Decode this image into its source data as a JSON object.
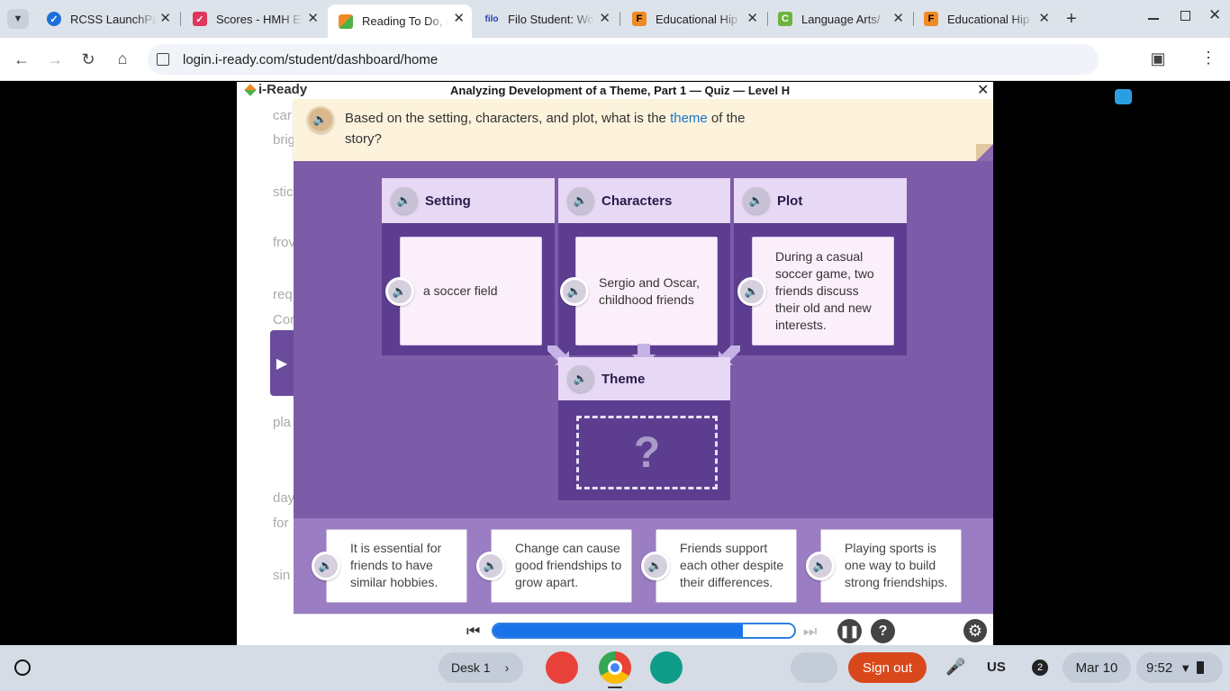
{
  "browser": {
    "tabs": [
      {
        "title": "RCSS LaunchPad",
        "icon": "launchpad-icon",
        "color": "#1e6fd9"
      },
      {
        "title": "Scores - HMH Ed",
        "icon": "hmh-icon",
        "color": "#e0355c"
      },
      {
        "title": "Reading To Do, i-Ready",
        "icon": "iready-icon",
        "color": "#f08a24"
      },
      {
        "title": "Filo Student: World",
        "icon": "filo-icon",
        "color": "#2a3fb0"
      },
      {
        "title": "Educational Hip",
        "icon": "flocabulary-icon",
        "color": "#f08a24"
      },
      {
        "title": "Language Arts/",
        "icon": "commonlit-icon",
        "color": "#6cb33f"
      },
      {
        "title": "Educational Hip",
        "icon": "flocabulary-icon",
        "color": "#f08a24"
      }
    ],
    "url": "login.i-ready.com/student/dashboard/home"
  },
  "quiz": {
    "brand": "i-Ready",
    "title": "Analyzing Development of a Theme, Part 1 — Quiz — Level H",
    "prompt_before": "Based on the setting, characters, and plot, what is the ",
    "prompt_keyword": "theme",
    "prompt_after": " of the story?",
    "columns": [
      {
        "heading": "Setting",
        "text": "a soccer field"
      },
      {
        "heading": "Characters",
        "text": "Sergio and Oscar, childhood friends"
      },
      {
        "heading": "Plot",
        "text": "During a casual soccer game, two friends discuss their old and new interests."
      }
    ],
    "theme_heading": "Theme",
    "theme_placeholder": "?",
    "answers": [
      "It is essential for friends to have similar hobbies.",
      "Change can cause good friendships to grow apart.",
      "Friends support each other despite their differences.",
      "Playing sports is one way to build strong friendships."
    ],
    "progress": 0.83
  },
  "background_text": [
    "car",
    "brig",
    "stic",
    "frov",
    "req",
    "Cor",
    "pla",
    "day",
    "for",
    "sin"
  ],
  "shelf": {
    "desk": "Desk 1",
    "sign_out": "Sign out",
    "ime": "US",
    "notifications": "2",
    "date": "Mar 10",
    "time": "9:52"
  }
}
